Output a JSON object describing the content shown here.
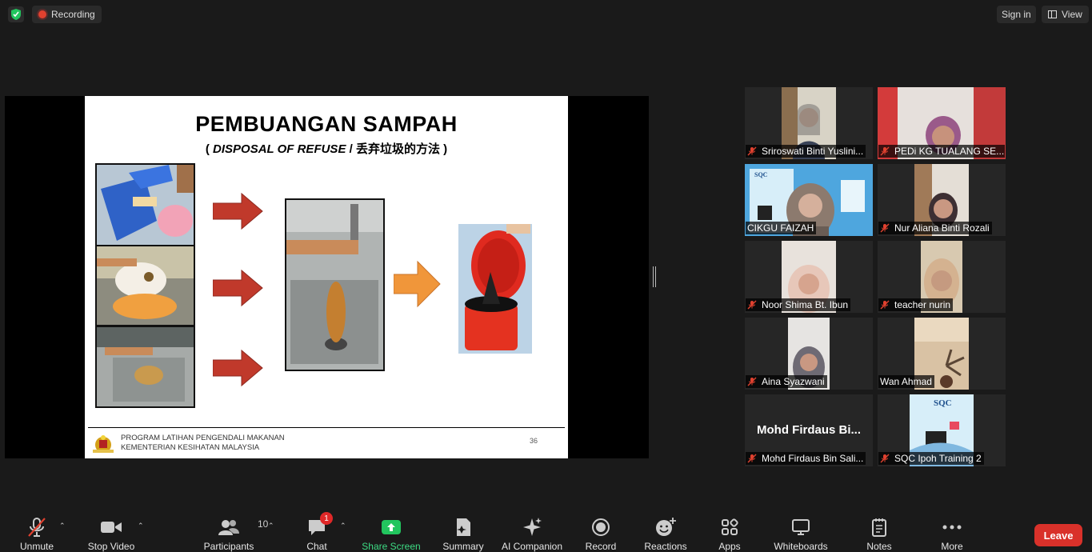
{
  "topbar": {
    "recording_label": "Recording",
    "sign_in_label": "Sign in",
    "view_label": "View"
  },
  "slide": {
    "title": "PEMBUANGAN SAMPAH",
    "subtitle_open": "( ",
    "subtitle_en": "DISPOSAL OF REFUSE",
    "subtitle_sep": " / 丢弃垃圾的方法 )",
    "footer_line1": "PROGRAM LATIHAN PENGENDALI MAKANAN",
    "footer_line2": "KEMENTERIAN KESIHATAN MALAYSIA",
    "page_number": "36"
  },
  "participants": [
    {
      "name": "Sriroswati Binti Yuslini...",
      "muted": true
    },
    {
      "name": "PEDi KG TUALANG SE...",
      "muted": true
    },
    {
      "name": "CIKGU FAIZAH",
      "muted": false,
      "active_speaker": true
    },
    {
      "name": "Nur Aliana Binti Rozali",
      "muted": true
    },
    {
      "name": "Noor Shima Bt. Ibun",
      "muted": true
    },
    {
      "name": "teacher nurin",
      "muted": true
    },
    {
      "name": "Aina Syazwani",
      "muted": true
    },
    {
      "name": "Wan Ahmad",
      "muted": false
    },
    {
      "name": "Mohd Firdaus Bin Sali...",
      "display_name": "Mohd Firdaus Bi...",
      "muted": true
    },
    {
      "name": "SQC Ipoh Training 2",
      "muted": true
    }
  ],
  "toolbar": {
    "unmute": "Unmute",
    "stop_video": "Stop Video",
    "participants": "Participants",
    "participants_count": "10",
    "chat": "Chat",
    "chat_badge": "1",
    "share_screen": "Share Screen",
    "summary": "Summary",
    "ai_companion": "AI Companion",
    "record": "Record",
    "reactions": "Reactions",
    "apps": "Apps",
    "whiteboards": "Whiteboards",
    "notes": "Notes",
    "more": "More",
    "leave": "Leave"
  },
  "colors": {
    "background": "#1a1a1a",
    "active_speaker_border": "#f2e36a",
    "share_green": "#22c55e",
    "leave_red": "#d9312a",
    "mic_off_red": "#e0412f",
    "slide_arrow_red": "#c0392b",
    "slide_arrow_orange": "#f0963a"
  }
}
